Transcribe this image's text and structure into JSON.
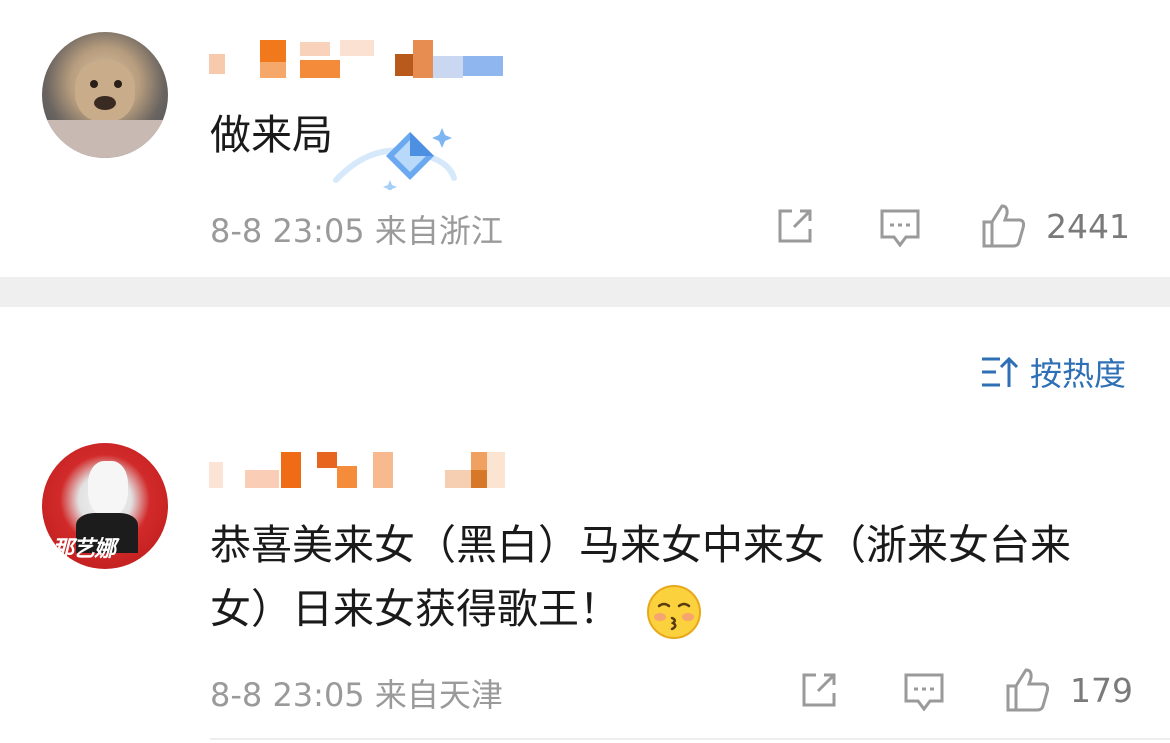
{
  "comments": [
    {
      "username": "",
      "text": "做来局",
      "meta": "8-8 23:05 来自浙江",
      "likes": "2441",
      "badge_icon": "diamond-badge-icon"
    },
    {
      "username": "",
      "text_line1": "恭喜美来女（黑白）马来女中来女（浙来女台来",
      "text_line2": "女）日来女获得歌王！",
      "emoji_icon": "kissing-face-emoji",
      "meta": "8-8 23:05 来自天津",
      "likes": "179",
      "avatar_text": "那艺娜"
    }
  ],
  "sort": {
    "label": "按热度",
    "icon": "sort-icon"
  },
  "colors": {
    "accent": "#2f6fb5",
    "meta": "#9a9a9a",
    "divider": "#efefef"
  }
}
